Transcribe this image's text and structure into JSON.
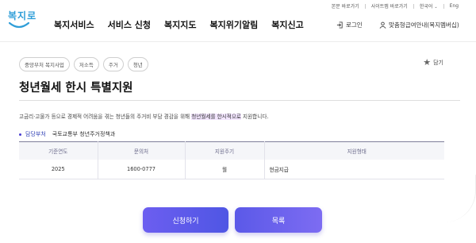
{
  "util_bar": {
    "items": [
      "본문 바로가기",
      "사이트맵 바로가기",
      "한국어",
      "Eng"
    ],
    "lang_caret": "⌄"
  },
  "logo": {
    "text": "복지로"
  },
  "gnb": [
    "복지서비스",
    "서비스 신청",
    "복지지도",
    "복지위기알림",
    "복지신고"
  ],
  "header_right": {
    "login": "로그인",
    "cs": "맞춤형급여안내(복지멤버십)"
  },
  "tags": [
    "중앙부처 복지사업",
    "저소득",
    "주거",
    "청년"
  ],
  "favorite": {
    "label": "담기"
  },
  "title": "청년월세 한시 특별지원",
  "description": {
    "before": "고금리·고물가 등으로 경제적 어려움을 겪는 청년들의 주거비 부담 경감을 위해 ",
    "highlight": "청년월세를 한시적으로",
    "after": " 지원합니다."
  },
  "department": {
    "label": "담당부처",
    "value": "국토교통부 청년주거정책과"
  },
  "table": {
    "headers": [
      "기준연도",
      "문의처",
      "지원주기",
      "지원형태"
    ],
    "rows": [
      [
        "2025",
        "1600-0777",
        "월",
        "현금지급"
      ]
    ]
  },
  "buttons": {
    "apply": "신청하기",
    "list": "목록"
  },
  "colors": {
    "brand": "#2f9ed8",
    "accent": "#5b59e8",
    "dept_label": "#2f3fb4"
  }
}
